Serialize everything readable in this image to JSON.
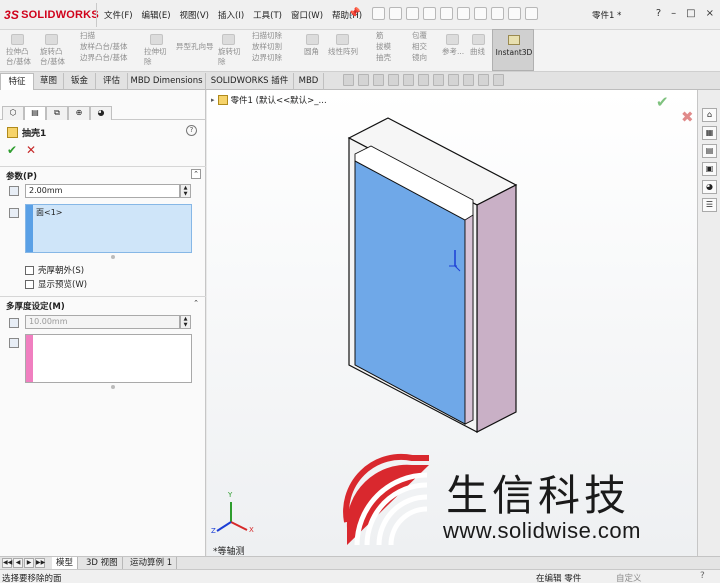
{
  "app": {
    "logo": "SOLIDWORKS",
    "logo_prefix": "3S",
    "menus": [
      "文件(F)",
      "编辑(E)",
      "视图(V)",
      "插入(I)",
      "工具(T)",
      "窗口(W)",
      "帮助(H)"
    ],
    "document_title": "零件1 *",
    "window_controls": [
      "?",
      "–",
      "□",
      "×"
    ]
  },
  "ribbon": {
    "items": [
      "拉伸凸台/基体",
      "旋转凸台/基体",
      "扫描",
      "放样凸台/基体",
      "边界凸台/基体",
      "拉伸切除",
      "异型孔向导",
      "旋转切除",
      "扫描切除",
      "放样切割",
      "边界切除",
      "圆角",
      "线性阵列",
      "筋",
      "拔模",
      "抽壳",
      "包覆",
      "相交",
      "镜向",
      "参考...",
      "曲线"
    ],
    "instant3d": "Instant3D"
  },
  "tabs": [
    "特征",
    "草图",
    "钣金",
    "评估",
    "MBD Dimensions",
    "SOLIDWORKS 插件",
    "MBD"
  ],
  "active_tab": "特征",
  "panel": {
    "feature_name": "抽壳1",
    "help": "?",
    "ok": "✔",
    "cancel": "✕",
    "params_title": "参数(P)",
    "thickness": "2.00mm",
    "faces": [
      "面<1>"
    ],
    "shell_outward": "壳厚朝外(S)",
    "show_preview": "显示预览(W)",
    "multi_title": "多厚度设定(M)",
    "multi_thickness": "10.00mm"
  },
  "graphics": {
    "tree_item": "零件1 (默认<<默认>_...",
    "view_label": "*等轴测",
    "triad_labels": [
      "Y",
      "X",
      "Z"
    ],
    "watermark_text": "生信科技",
    "watermark_url": "www.solidwise.com"
  },
  "bottom_tabs": [
    "模型",
    "3D 视图",
    "运动算例 1"
  ],
  "status": {
    "message": "选择要移除的面",
    "mode": "在编辑 零件",
    "units": "自定义",
    "help": "?"
  },
  "colors": {
    "brand_red": "#d0021b",
    "face_blue": "#6fa8e8",
    "side_mauve": "#c9b0c6",
    "selection_box": "#cfe5f9",
    "multi_thickness_stripe": "#f07fc0"
  }
}
